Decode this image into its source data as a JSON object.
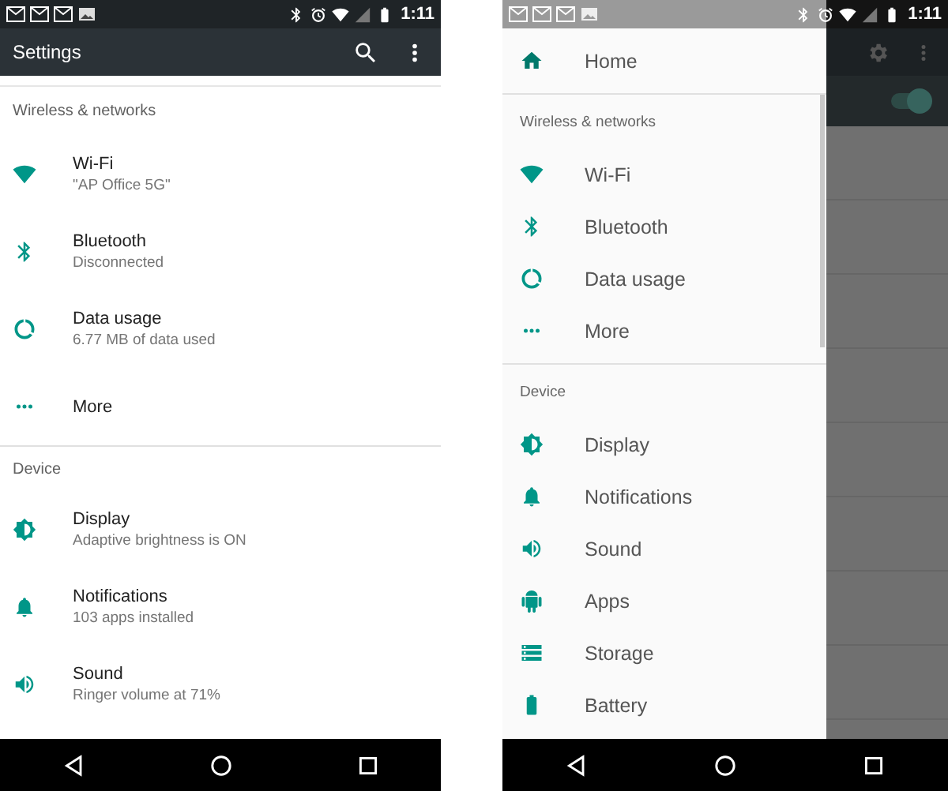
{
  "settings_screen": {
    "status_time": "1:11",
    "title": "Settings",
    "sections": [
      {
        "header": "Wireless & networks",
        "items": [
          {
            "kind": "wifi",
            "title": "Wi-Fi",
            "subtitle": "\"AP Office 5G\""
          },
          {
            "kind": "bluetooth",
            "title": "Bluetooth",
            "subtitle": "Disconnected"
          },
          {
            "kind": "data",
            "title": "Data usage",
            "subtitle": "6.77 MB of data used"
          },
          {
            "kind": "more",
            "title": "More"
          }
        ]
      },
      {
        "header": "Device",
        "items": [
          {
            "kind": "display",
            "title": "Display",
            "subtitle": "Adaptive brightness is ON"
          },
          {
            "kind": "bell",
            "title": "Notifications",
            "subtitle": "103 apps installed"
          },
          {
            "kind": "sound",
            "title": "Sound",
            "subtitle": "Ringer volume at 71%"
          }
        ]
      }
    ]
  },
  "drawer_screen": {
    "status_time": "1:11",
    "home": {
      "kind": "home",
      "title": "Home"
    },
    "sections": [
      {
        "header": "Wireless & networks",
        "items": [
          {
            "kind": "wifi",
            "title": "Wi-Fi"
          },
          {
            "kind": "bluetooth",
            "title": "Bluetooth"
          },
          {
            "kind": "data",
            "title": "Data usage"
          },
          {
            "kind": "more",
            "title": "More"
          }
        ]
      },
      {
        "header": "Device",
        "items": [
          {
            "kind": "display",
            "title": "Display"
          },
          {
            "kind": "bell",
            "title": "Notifications"
          },
          {
            "kind": "sound",
            "title": "Sound"
          },
          {
            "kind": "android",
            "title": "Apps"
          },
          {
            "kind": "storage",
            "title": "Storage"
          },
          {
            "kind": "battery",
            "title": "Battery"
          }
        ]
      }
    ],
    "background_switch": {
      "on": true
    }
  }
}
